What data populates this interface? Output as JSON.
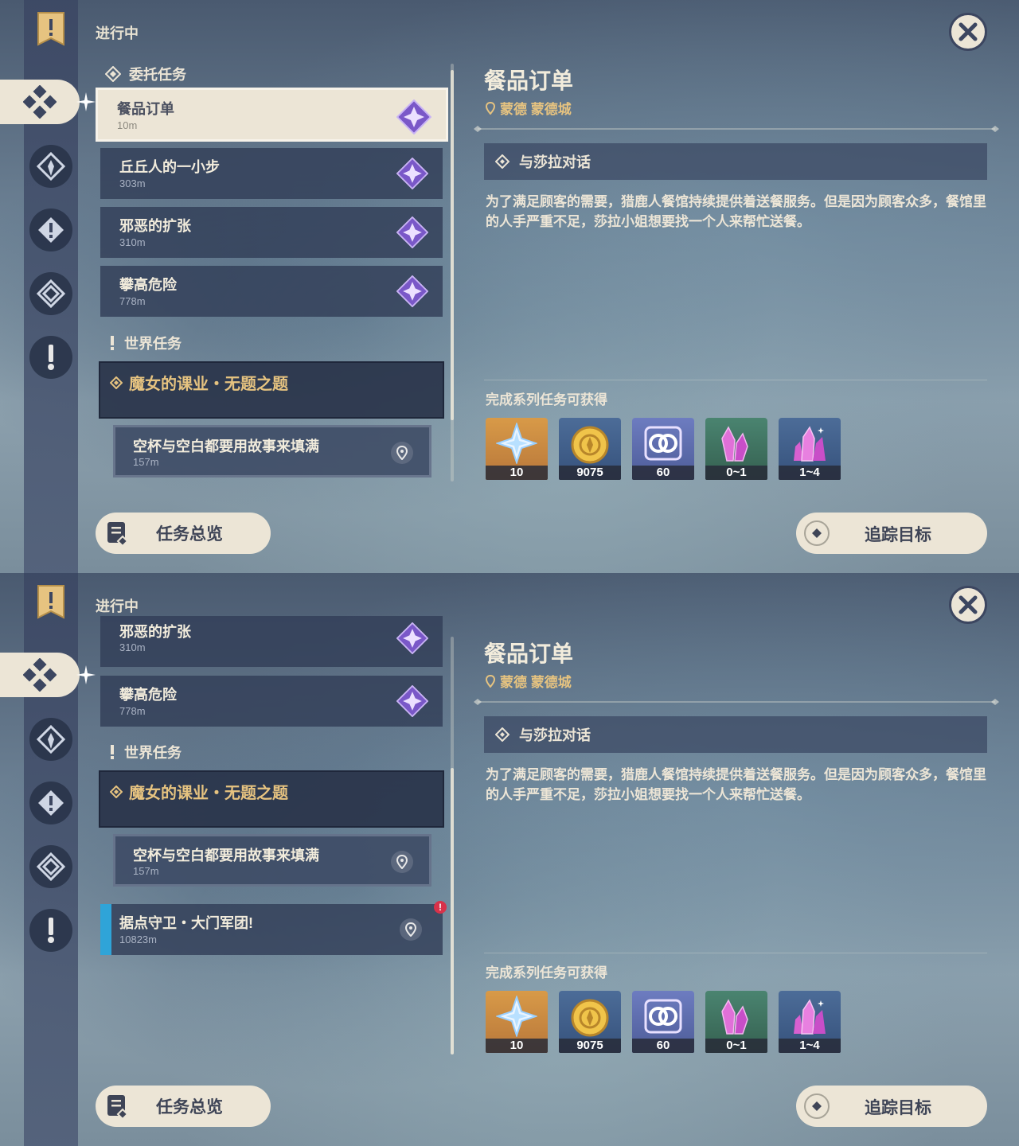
{
  "header": {
    "label": "进行中"
  },
  "sections": {
    "commission": "委托任务",
    "world": "世界任务"
  },
  "quests": [
    {
      "title": "餐品订单",
      "distance": "10m"
    },
    {
      "title": "丘丘人的一小步",
      "distance": "303m"
    },
    {
      "title": "邪恶的扩张",
      "distance": "310m"
    },
    {
      "title": "攀高危险",
      "distance": "778m"
    }
  ],
  "world_quest": {
    "title": "魔女的课业・无题之题",
    "sub": {
      "title": "空杯与空白都要用故事来填满",
      "distance": "157m"
    }
  },
  "extra_quest": {
    "title": "据点守卫・大门军团!",
    "distance": "10823m",
    "badge": "!"
  },
  "detail": {
    "title": "餐品订单",
    "location": "蒙德 蒙德城",
    "objective": "与莎拉对话",
    "description": "为了满足顾客的需要，猎鹿人餐馆持续提供着送餐服务。但是因为顾客众多，餐馆里的人手严重不足，莎拉小姐想要找一个人来帮忙送餐。",
    "rewards_label": "完成系列任务可获得",
    "rewards": [
      {
        "icon": "primogem-icon",
        "count": "10",
        "bg": "#c8873a"
      },
      {
        "icon": "mora-icon",
        "count": "9075",
        "bg": "#3c5a84"
      },
      {
        "icon": "companionship-exp-icon",
        "count": "60",
        "bg": "#5a6ca0"
      },
      {
        "icon": "crystal-chunk-icon",
        "count": "0~1",
        "bg": "#3d7060"
      },
      {
        "icon": "crystal-cluster-icon",
        "count": "1~4",
        "bg": "#3c5a84"
      }
    ]
  },
  "buttons": {
    "overview": "任务总览",
    "track": "追踪目标"
  },
  "colors": {
    "accent": "#e6c380",
    "panel": "#ece5d6",
    "urgent": "#d8324a"
  }
}
